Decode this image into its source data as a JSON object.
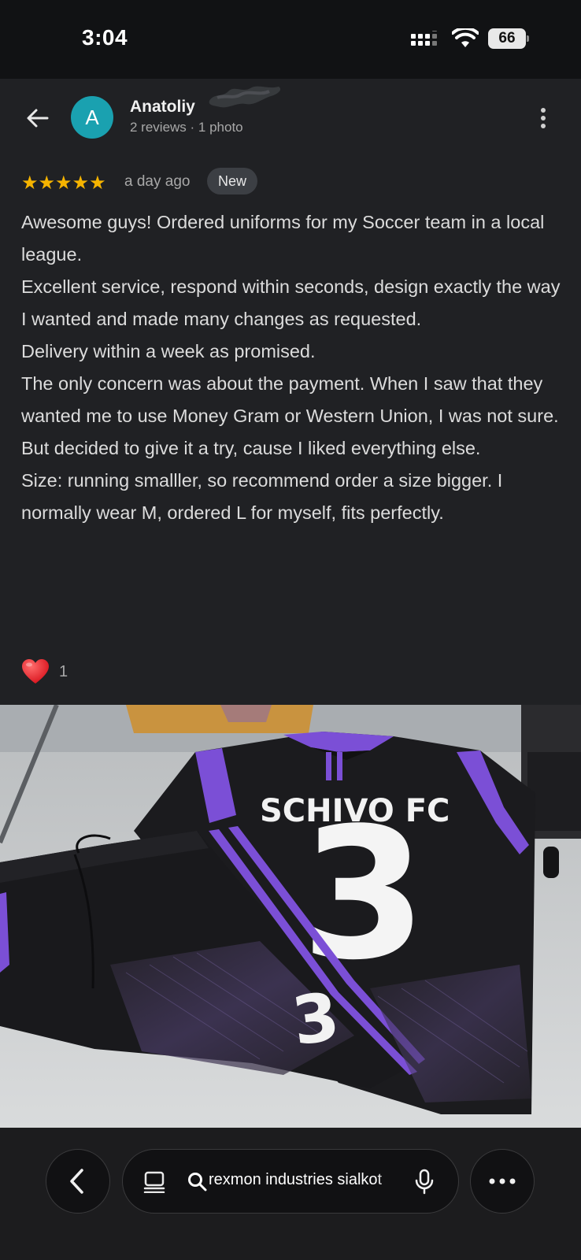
{
  "status_bar": {
    "time": "3:04",
    "battery": "66",
    "icons": [
      "cellular-signal-icon",
      "wifi-icon",
      "battery-icon"
    ]
  },
  "header": {
    "back_icon": "arrow-left-icon",
    "avatar_letter": "A",
    "avatar_color": "#1aa1b0",
    "reviewer_name": "Anatoliy",
    "reviewer_meta": "2 reviews · 1 photo",
    "more_icon": "more-vertical-icon"
  },
  "review": {
    "stars": "★★★★★",
    "rating": 5,
    "age": "a day ago",
    "badge": "New",
    "paragraphs": [
      "Awesome guys! Ordered uniforms for my Soccer team in a local league.",
      "Excellent service, respond within seconds, design exactly the way I wanted and made many changes as requested.",
      "Delivery within a week as promised.",
      "The only concern was about the payment. When I saw that they wanted me to use Money Gram or Western Union, I was not sure. But decided to give it a try, cause I liked everything else.",
      "Size: running smalller, so recommend order a size bigger. I normally wear M, ordered L for myself, fits perfectly."
    ],
    "reaction_icon": "heart-icon",
    "reaction_count": "1"
  },
  "photo": {
    "jersey_text": "SCHIVO FC",
    "jersey_number": "3",
    "shorts_number": "3"
  },
  "browser_bar": {
    "back_icon": "chevron-left-icon",
    "reader_icon": "reader-mode-icon",
    "search_icon": "search-icon",
    "url_text": "rexmon industries sialkot",
    "mic_icon": "microphone-icon",
    "more_icon": "more-horizontal-icon"
  },
  "colors": {
    "background": "#202124",
    "star": "#f6b400",
    "accent_purple": "#7b4fd6"
  }
}
